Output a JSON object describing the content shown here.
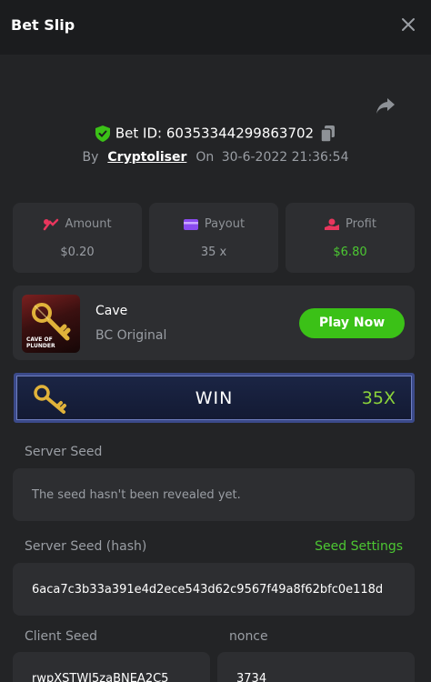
{
  "header": {
    "title": "Bet Slip",
    "close_icon": "close-icon"
  },
  "bet": {
    "id_label": "Bet ID: 60353344299863702",
    "by_label": "By",
    "user": "Cryptoliser",
    "on_label": "On",
    "date": "30-6-2022 21:36:54"
  },
  "stats": {
    "amount_label": "Amount",
    "amount_value": "$0.20",
    "payout_label": "Payout",
    "payout_value": "35 x",
    "profit_label": "Profit",
    "profit_value": "$6.80"
  },
  "game": {
    "thumb_caption_1": "CAVE OF",
    "thumb_caption_2": "PLUNDER",
    "name": "Cave",
    "sub": "BC Original",
    "play_label": "Play Now"
  },
  "result": {
    "label": "WIN",
    "multiplier": "35X"
  },
  "seeds": {
    "server_seed_label": "Server Seed",
    "server_seed_value": "The seed hasn't been revealed yet.",
    "server_hash_label": "Server Seed (hash)",
    "seed_settings_label": "Seed Settings",
    "server_hash_value": "6aca7c3b33a391e4d2ece543d62c9567f49a8f62bfc0e118d",
    "client_seed_label": "Client Seed",
    "client_seed_value": "rwpXSTWJ5zaBNEA2C5",
    "nonce_label": "nonce",
    "nonce_value": "3734"
  },
  "colors": {
    "accent_green": "#3bc117",
    "profit_green": "#4cc732",
    "panel": "#232426",
    "card": "#2d2e31"
  }
}
